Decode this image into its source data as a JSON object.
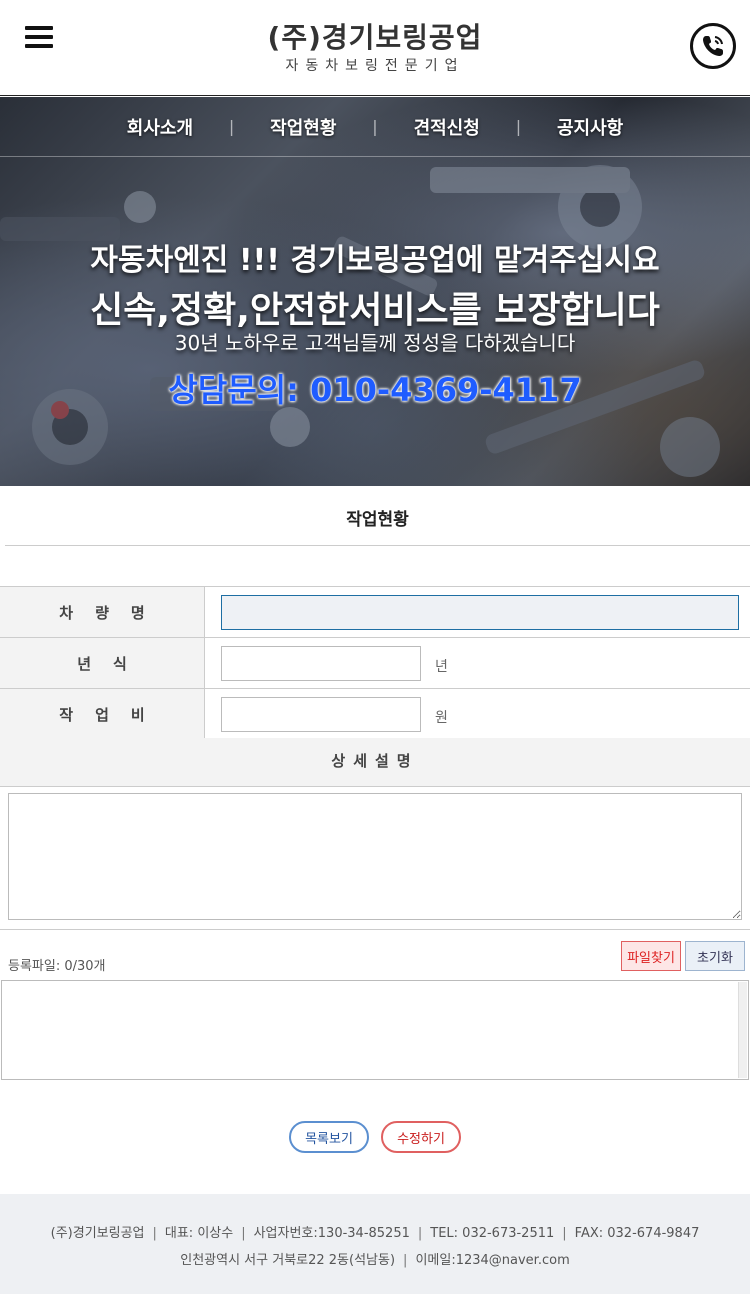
{
  "header": {
    "logo_title": "(주)경기보링공업",
    "logo_subtitle": "자동차보링전문기업",
    "menu_icon": "hamburger-menu-icon",
    "phone_icon": "phone-call-icon"
  },
  "nav": {
    "items": [
      {
        "label": "회사소개"
      },
      {
        "label": "작업현황"
      },
      {
        "label": "견적신청"
      },
      {
        "label": "공지사항"
      }
    ]
  },
  "hero": {
    "line1": "자동차엔진 !!! 경기보링공업에 맡겨주십시요",
    "line2": "신속,정확,안전한서비스를 보장합니다",
    "line3": "30년 노하우로 고객님들께 정성을 다하겠습니다",
    "line4": "상담문의: 010-4369-4117",
    "accent_color": "#1f5cff"
  },
  "section": {
    "title": "작업현황"
  },
  "form": {
    "car_name_label": "차량명",
    "car_name_value": "",
    "year_label": "년식",
    "year_value": "",
    "year_unit": "년",
    "cost_label": "작업비",
    "cost_value": "",
    "cost_unit": "원",
    "description_label": "상세설명",
    "description_value": ""
  },
  "files": {
    "label": "등록파일: 0/30개",
    "find_button": "파일찾기",
    "reset_button": "초기화"
  },
  "actions": {
    "list_button": "목록보기",
    "edit_button": "수정하기"
  },
  "footer": {
    "company": "(주)경기보링공업",
    "ceo": "대표: 이상수",
    "biz_no": "사업자번호:130-34-85251",
    "tel": "TEL: 032-673-2511",
    "fax": "FAX: 032-674-9847",
    "address": "인천광역시 서구 거북로22 2동(석남동)",
    "email": "이메일:1234@naver.com"
  }
}
